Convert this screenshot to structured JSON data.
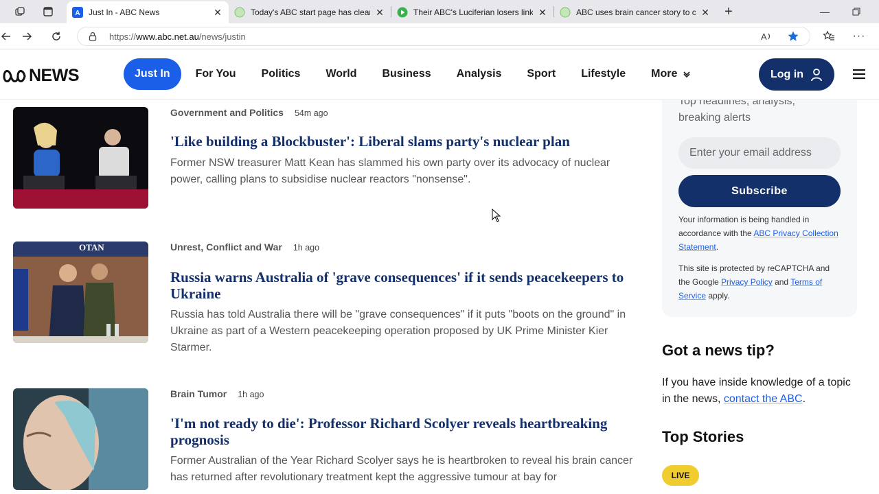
{
  "browser": {
    "tabs": [
      {
        "title": "Just In - ABC News",
        "active": true,
        "favicon": "abc-favicon"
      },
      {
        "title": "Today's ABC start page has clear s",
        "active": false,
        "favicon": "globe-favicon"
      },
      {
        "title": "Their ABC's Luciferian losers link l",
        "active": false,
        "favicon": "play-favicon"
      },
      {
        "title": "ABC uses brain cancer story to ca",
        "active": false,
        "favicon": "globe-favicon"
      }
    ],
    "url_prefix": "https://",
    "url_host": "www.abc.net.au",
    "url_path": "/news/justin"
  },
  "site": {
    "logo_text": "NEWS",
    "nav": [
      "Just In",
      "For You",
      "Politics",
      "World",
      "Business",
      "Analysis",
      "Sport",
      "Lifestyle",
      "More"
    ],
    "login_label": "Log in"
  },
  "stories": [
    {
      "topic": "Government and Politics",
      "time": "54m ago",
      "headline": "'Like building a Blockbuster': Liberal slams party's nuclear plan",
      "summary": "Former NSW treasurer Matt Kean has slammed his own party over its advocacy of nuclear power, calling plans to subsidise nuclear reactors \"nonsense\"."
    },
    {
      "topic": "Unrest, Conflict and War",
      "time": "1h ago",
      "headline": "Russia warns Australia of 'grave consequences' if it sends peacekeepers to Ukraine",
      "summary": "Russia has told Australia there will be \"grave consequences\" if it puts \"boots on the ground\" in Ukraine as part of a Western peacekeeping operation proposed by UK Prime Minister Kier Starmer."
    },
    {
      "topic": "Brain Tumor",
      "time": "1h ago",
      "headline": "'I'm not ready to die': Professor Richard Scolyer reveals heartbreaking prognosis",
      "summary": "Former Australian of the Year Richard Scolyer says he is heartbroken to reveal his brain cancer has returned after revolutionary treatment kept the aggressive tumour at bay for"
    }
  ],
  "sidebar": {
    "sub_desc": "Top headlines, analysis, breaking alerts",
    "email_placeholder": "Enter your email address",
    "subscribe_label": "Subscribe",
    "privacy_pre": "Your information is being handled in accordance with the ",
    "privacy_link": "ABC Privacy Collection Statement",
    "privacy_post": ".",
    "recaptcha_pre": "This site is protected by reCAPTCHA and the Google ",
    "recaptcha_link1": "Privacy Policy",
    "recaptcha_mid": " and ",
    "recaptcha_link2": "Terms of Service",
    "recaptcha_post": " apply.",
    "tip_heading": "Got a news tip?",
    "tip_pre": "If you have inside knowledge of a topic in the news, ",
    "tip_link": "contact the ABC",
    "tip_post": ".",
    "top_stories_heading": "Top Stories",
    "live_label": "LIVE"
  },
  "colors": {
    "accent": "#1b5ee8",
    "navy": "#14306b",
    "live": "#f0cc2e"
  }
}
